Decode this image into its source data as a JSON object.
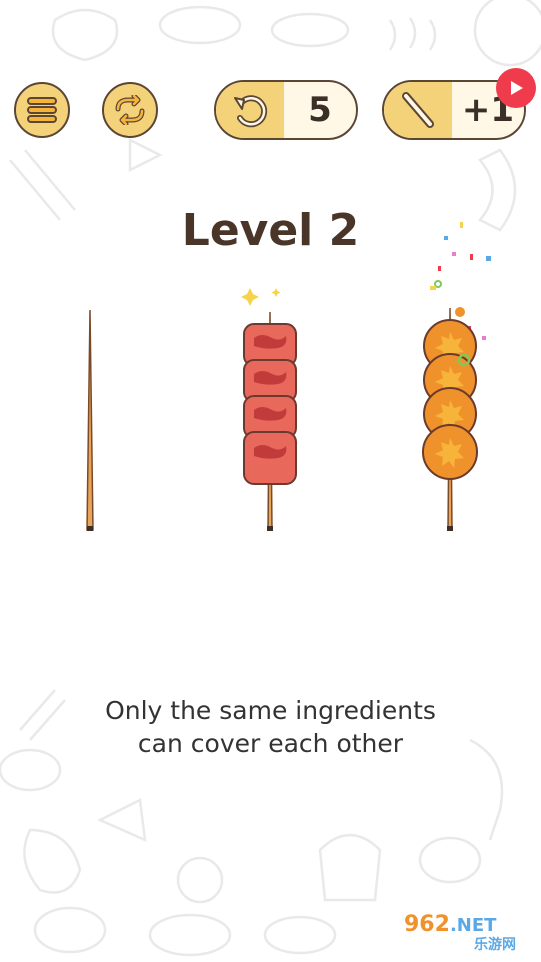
{
  "toolbar": {
    "menu_icon": "menu-icon",
    "restart_icon": "restart-icon",
    "undo_icon": "undo-arrow-icon",
    "undo_count": "5",
    "add_skewer_icon": "skewer-stick-icon",
    "add_skewer_label": "+1",
    "video_badge_icon": "play-video-icon"
  },
  "level": {
    "title": "Level 2"
  },
  "skewers": [
    {
      "id": "empty",
      "items": []
    },
    {
      "id": "meat",
      "items": [
        "meat",
        "meat",
        "meat",
        "meat"
      ]
    },
    {
      "id": "orange",
      "items": [
        "orange",
        "orange",
        "orange",
        "orange"
      ]
    }
  ],
  "hint": {
    "line1": "Only the same ingredients",
    "line2": "can cover each other"
  },
  "watermark": {
    "number": "962",
    "suffix": ".NET",
    "sub": "乐游网"
  },
  "colors": {
    "accent_yellow": "#f3d27a",
    "outline_brown": "#5b4634",
    "title_brown": "#4a3628",
    "badge_red": "#ef3b4b",
    "meat": "#e8685c",
    "orange": "#f0922b"
  }
}
